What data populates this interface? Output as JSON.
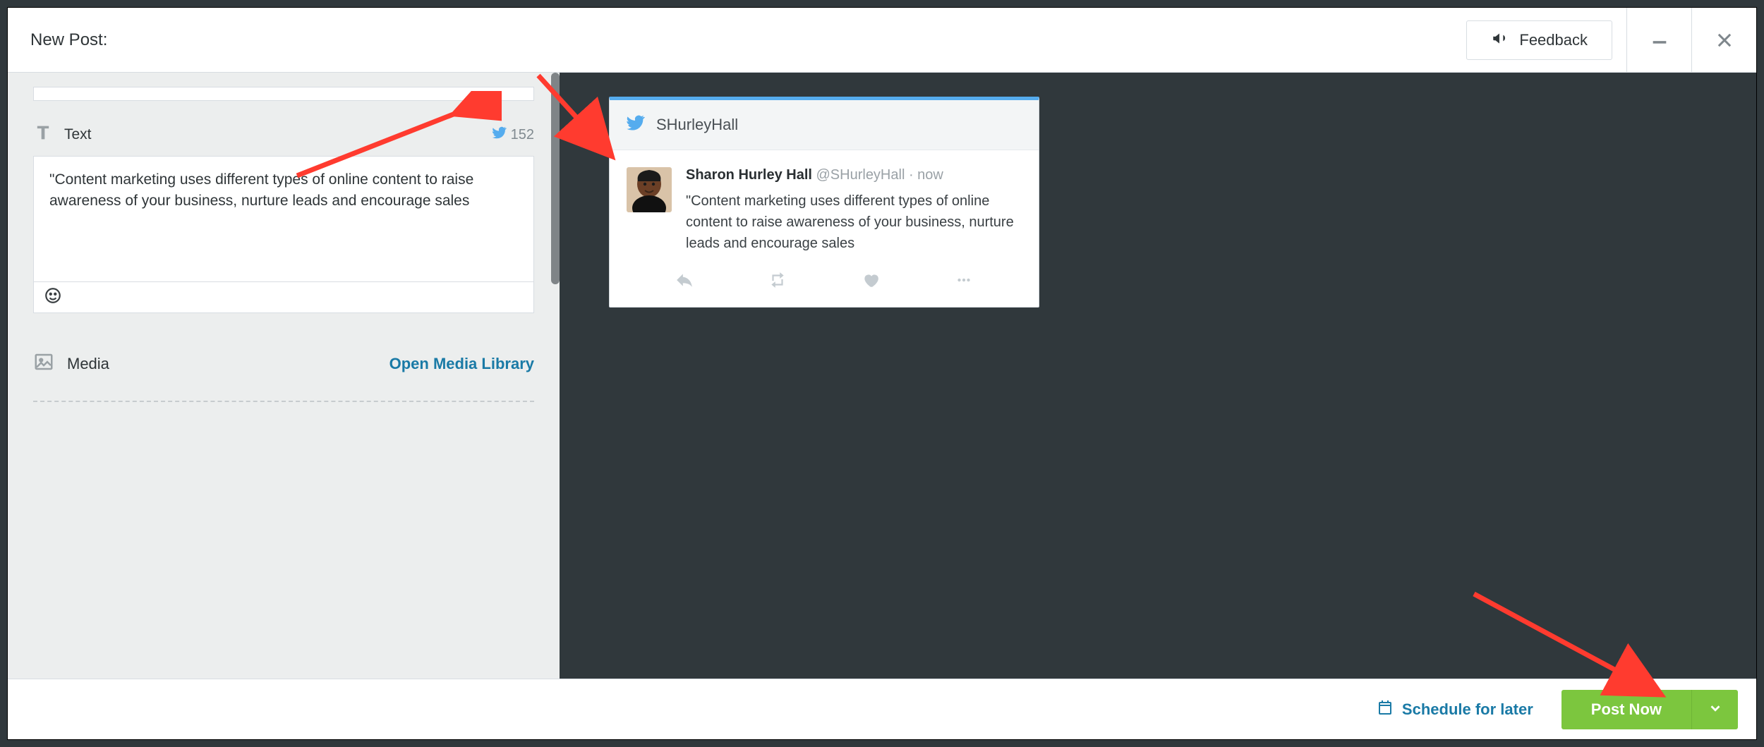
{
  "header": {
    "title": "New Post:",
    "feedback_label": "Feedback"
  },
  "compose": {
    "text_section_label": "Text",
    "char_count": "152",
    "text_value": "\"Content marketing uses different types of online content to raise awareness of your business, nurture leads and encourage sales",
    "media_section_label": "Media",
    "media_library_link": "Open Media Library"
  },
  "preview": {
    "account_handle": "SHurleyHall",
    "display_name": "Sharon Hurley Hall",
    "username": "@SHurleyHall",
    "timestamp": "now",
    "tweet_text": "\"Content marketing uses different types of online content to raise awareness of your business, nurture leads and encourage sales"
  },
  "footer": {
    "schedule_label": "Schedule for later",
    "post_label": "Post Now"
  }
}
